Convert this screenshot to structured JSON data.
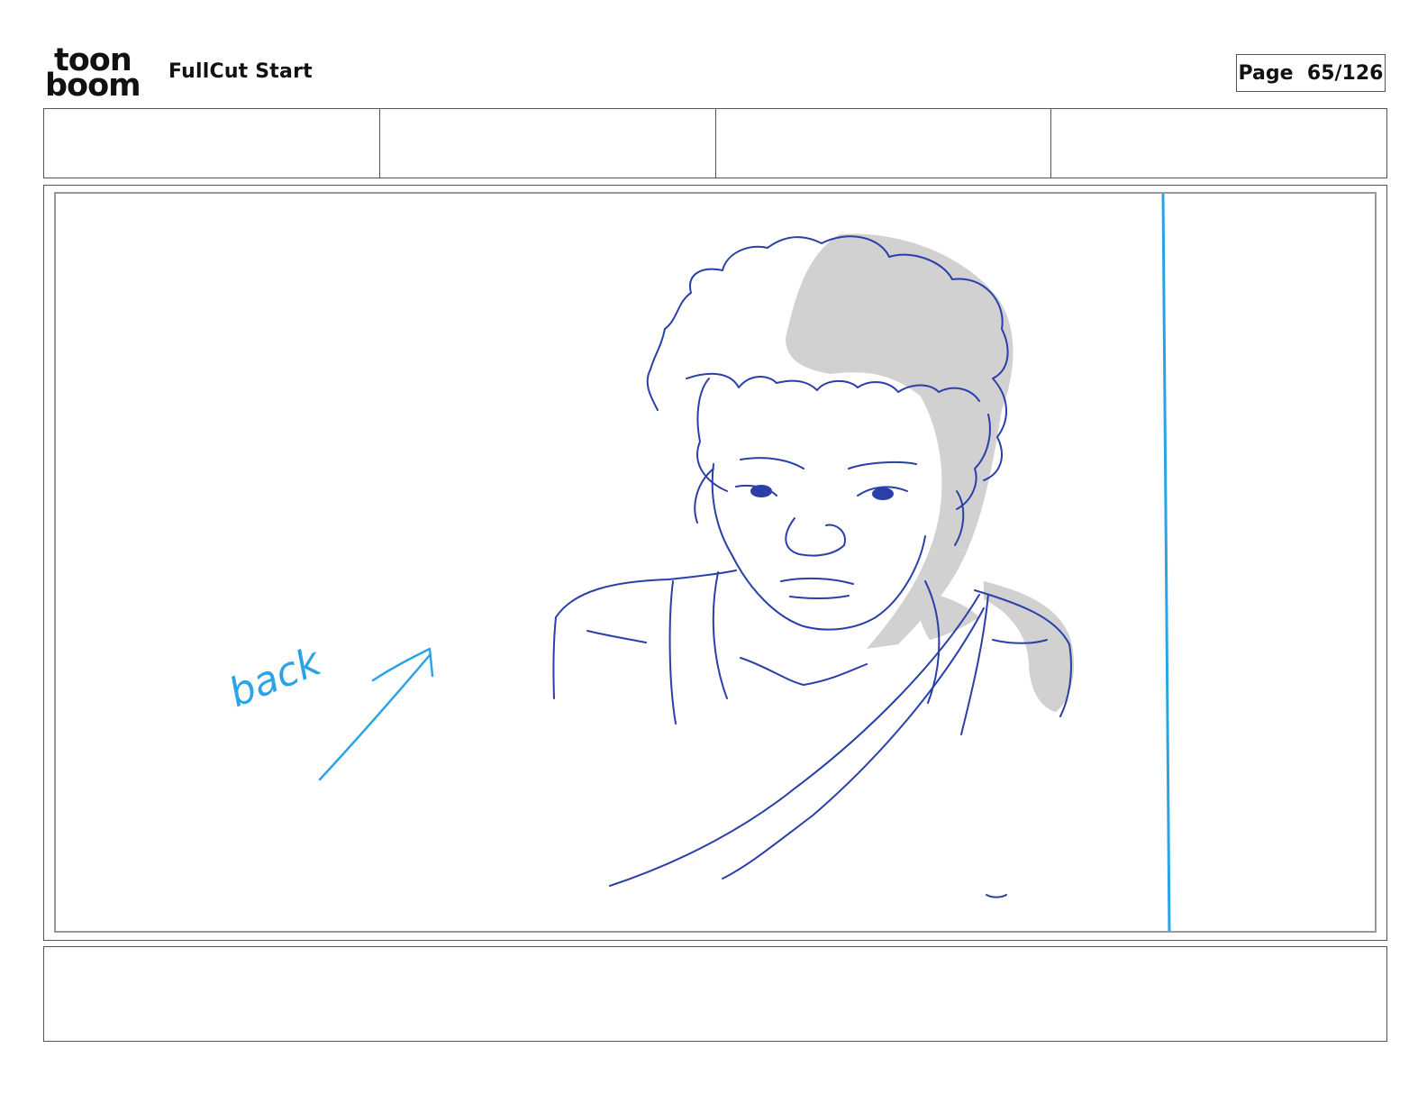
{
  "logo": {
    "line1": "toon",
    "line2": "boom"
  },
  "project": {
    "title": "FullCut Start"
  },
  "page": {
    "label": "Page",
    "current": "65",
    "total": "126",
    "display": "Page  65/126"
  },
  "header_fields": [
    "",
    "",
    "",
    ""
  ],
  "panel": {
    "annotation_text": "back",
    "colors": {
      "sketch_line": "#2a3fa8",
      "annotation": "#2aa4e6",
      "shadow": "#c8c8c8",
      "frame": "#9a9a9a"
    }
  },
  "notes": {
    "text": ""
  }
}
